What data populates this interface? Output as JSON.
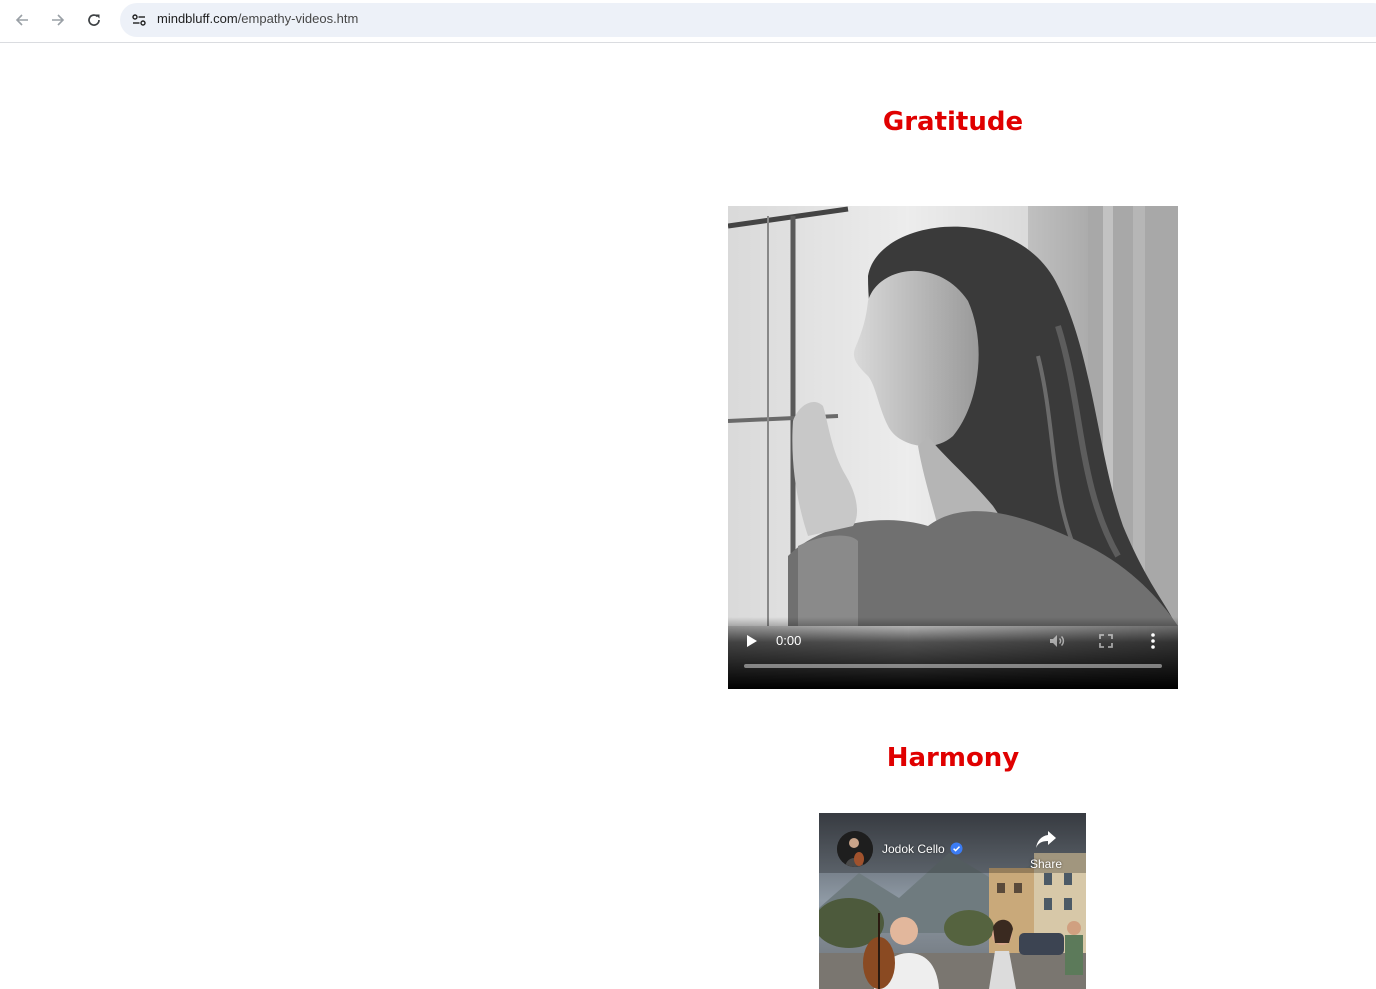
{
  "browser": {
    "url_domain": "mindbluff.com",
    "url_path": "/empathy-videos.htm"
  },
  "sections": [
    {
      "heading": "Gratitude",
      "player": {
        "time": "0:00",
        "progress": 0
      }
    },
    {
      "heading": "Harmony",
      "embed": {
        "channel": "Jodok Cello",
        "share_label": "Share"
      }
    }
  ],
  "colors": {
    "heading": "#e00000",
    "omnibox_bg": "#edf1f8",
    "verified": "#3b7cf5"
  },
  "icons": [
    "back-arrow-icon",
    "forward-arrow-icon",
    "reload-icon",
    "site-info-icon",
    "play-icon",
    "volume-icon",
    "fullscreen-icon",
    "more-options-icon",
    "verified-icon",
    "share-icon"
  ]
}
